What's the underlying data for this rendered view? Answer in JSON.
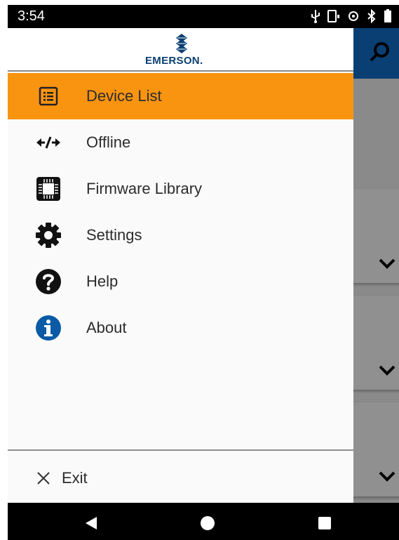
{
  "status_bar": {
    "time": "3:54",
    "icons": [
      "usb-icon",
      "screen-rotate-icon",
      "sync-icon",
      "bluetooth-icon",
      "battery-icon"
    ]
  },
  "brand": {
    "logo_text": "EMERSON.",
    "colors": {
      "brand_blue": "#0a3f73",
      "accent_orange": "#f99410"
    }
  },
  "drawer": {
    "items": [
      {
        "label": "Device List",
        "icon": "list-icon",
        "active": true
      },
      {
        "label": "Offline",
        "icon": "offline-icon",
        "active": false
      },
      {
        "label": "Firmware Library",
        "icon": "chip-icon",
        "active": false
      },
      {
        "label": "Settings",
        "icon": "gear-icon",
        "active": false
      },
      {
        "label": "Help",
        "icon": "help-icon",
        "active": false
      },
      {
        "label": "About",
        "icon": "info-icon",
        "active": false
      }
    ],
    "exit_label": "Exit"
  },
  "nav_bar": {
    "buttons": [
      "back-icon",
      "home-icon",
      "recents-icon"
    ]
  }
}
